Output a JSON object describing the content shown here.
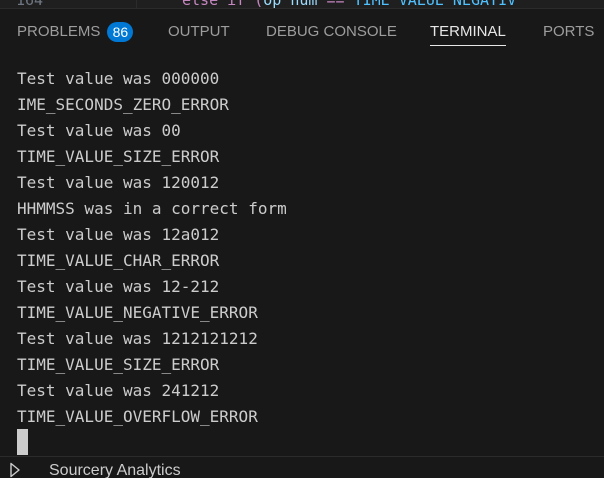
{
  "editor": {
    "line_number": "164",
    "code_keyword": "else if (",
    "code_ident": "op_num",
    "code_operator": " == ",
    "code_const": "TIME_VALUE_NEGATIV"
  },
  "panel": {
    "tabs": [
      {
        "label": "PROBLEMS",
        "badge": "86",
        "active": false
      },
      {
        "label": "OUTPUT",
        "active": false
      },
      {
        "label": "DEBUG CONSOLE",
        "active": false
      },
      {
        "label": "TERMINAL",
        "active": true
      },
      {
        "label": "PORTS",
        "active": false
      }
    ]
  },
  "terminal": {
    "lines": [
      "Test value was 000000",
      "IME_SECONDS_ZERO_ERROR",
      "Test value was 00",
      "TIME_VALUE_SIZE_ERROR",
      "Test value was 120012",
      "HHMMSS was in a correct form",
      "Test value was 12a012",
      "TIME_VALUE_CHAR_ERROR",
      "Test value was 12-212",
      "TIME_VALUE_NEGATIVE_ERROR",
      "Test value was 1212121212",
      "TIME_VALUE_SIZE_ERROR",
      "Test value was 241212",
      "TIME_VALUE_OVERFLOW_ERROR"
    ]
  },
  "sidebar_section": {
    "title": "Sourcery Analytics",
    "icon": "chevron-right-icon"
  },
  "colors": {
    "background": "#181818",
    "text": "#cccccc",
    "tab_inactive": "#9d9d9d",
    "tab_active": "#e7e7e7",
    "badge": "#0078d4"
  }
}
